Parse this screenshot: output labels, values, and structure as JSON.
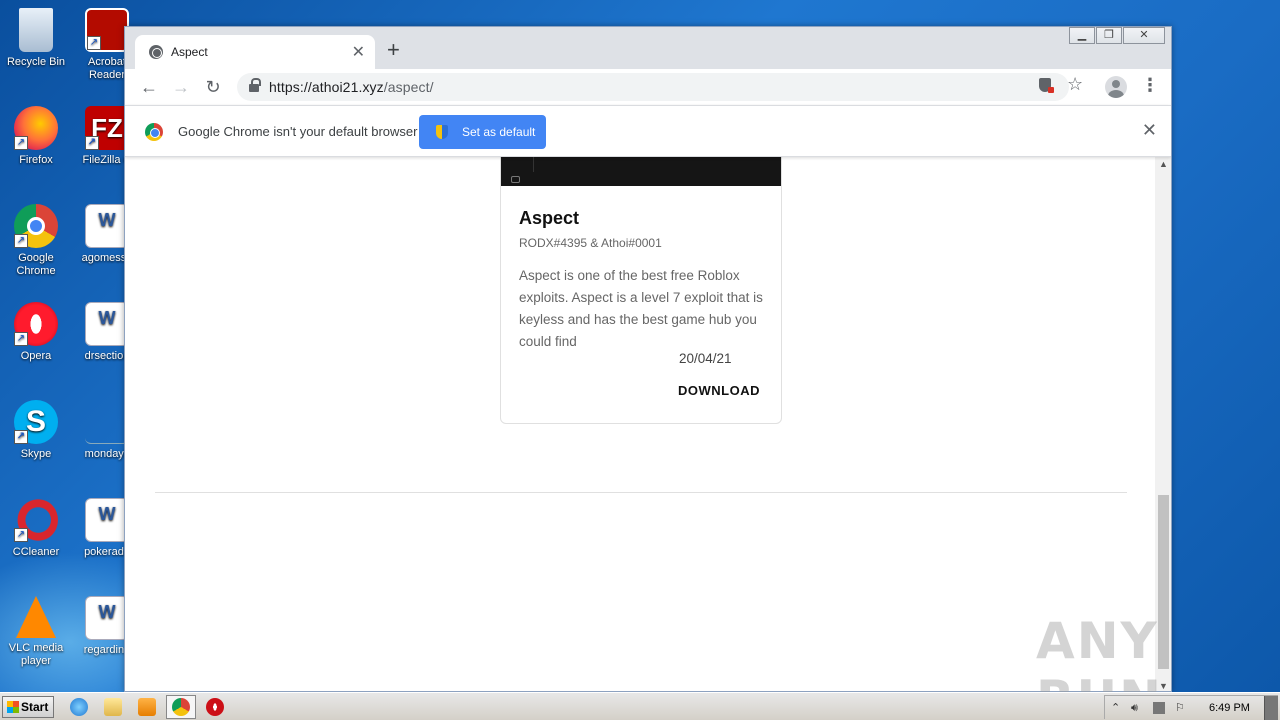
{
  "desktop": {
    "icons": [
      {
        "label": "Recycle Bin",
        "icon": "recycle-bin-icon"
      },
      {
        "label": "Acrobat Reader",
        "icon": "acrobat-icon"
      },
      {
        "label": "Firefox",
        "icon": "firefox-icon"
      },
      {
        "label": "FileZilla C",
        "icon": "filezilla-icon"
      },
      {
        "label": "Google Chrome",
        "icon": "chrome-icon"
      },
      {
        "label": "agomessa",
        "icon": "word-doc-icon"
      },
      {
        "label": "Opera",
        "icon": "opera-icon"
      },
      {
        "label": "drsection",
        "icon": "word-doc-icon"
      },
      {
        "label": "Skype",
        "icon": "skype-icon"
      },
      {
        "label": "mondayk",
        "icon": "blank-file-icon"
      },
      {
        "label": "CCleaner",
        "icon": "ccleaner-icon"
      },
      {
        "label": "pokerado",
        "icon": "word-doc-icon"
      },
      {
        "label": "VLC media player",
        "icon": "vlc-icon"
      },
      {
        "label": "regarding",
        "icon": "word-doc-icon"
      }
    ]
  },
  "browser": {
    "tab_title": "Aspect",
    "new_tab_symbol": "+",
    "url_host": "https://athoi21.xyz",
    "url_path": "/aspect/",
    "infobar_text": "Google Chrome isn't your default browser",
    "set_default_label": "Set as default"
  },
  "card": {
    "title": "Aspect",
    "authors": "RODX#4395 & Athoi#0001",
    "description": "Aspect is one of the best free Roblox exploits. Aspect is a level 7 exploit that is keyless and has the best game hub you could find",
    "date": "20/04/21",
    "download_label": "DOWNLOAD"
  },
  "watermark": "ANY RUN",
  "taskbar": {
    "start_label": "Start",
    "clock": "6:49 PM"
  }
}
